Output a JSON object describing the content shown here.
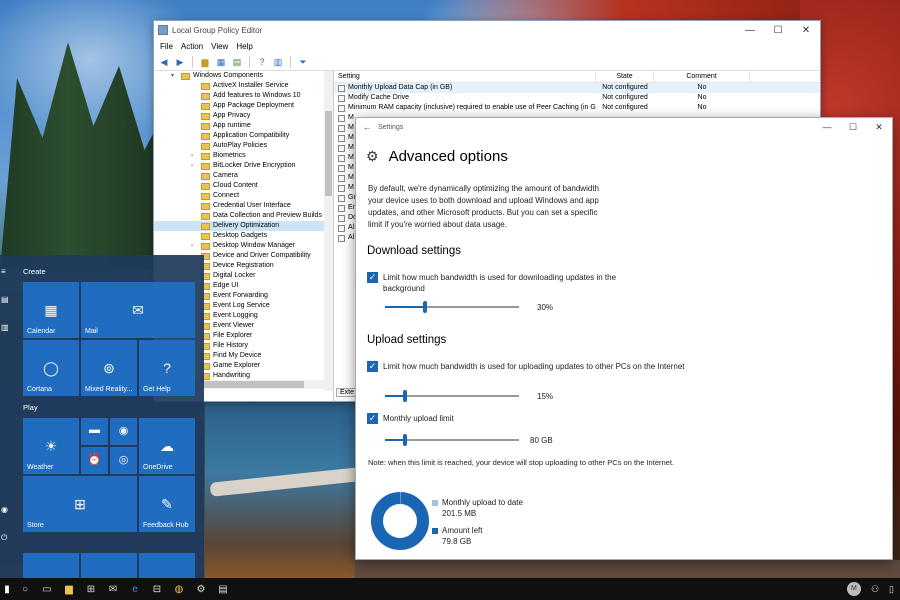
{
  "gpe": {
    "title": "Local Group Policy Editor",
    "menu": [
      "File",
      "Action",
      "View",
      "Help"
    ],
    "tree_root": "Windows Components",
    "tree_items": [
      "ActiveX Installer Service",
      "Add features to Windows 10",
      "App Package Deployment",
      "App Privacy",
      "App runtime",
      "Application Compatibility",
      "AutoPlay Policies",
      "Biometrics",
      "BitLocker Drive Encryption",
      "Camera",
      "Cloud Content",
      "Connect",
      "Credential User Interface",
      "Data Collection and Preview Builds",
      "Delivery Optimization",
      "Desktop Gadgets",
      "Desktop Window Manager",
      "Device and Driver Compatibility",
      "Device Registration",
      "Digital Locker",
      "Edge UI",
      "Event Forwarding",
      "Event Log Service",
      "Event Logging",
      "Event Viewer",
      "File Explorer",
      "File History",
      "Find My Device",
      "Game Explorer",
      "Handwriting"
    ],
    "selected_tree_item": "Delivery Optimization",
    "columns": {
      "setting": "Setting",
      "state": "State",
      "comment": "Comment"
    },
    "settings_rows": [
      {
        "name": "Monthly Upload Data Cap (in GB)",
        "state": "Not configured",
        "comment": "No"
      },
      {
        "name": "Modify Cache Drive",
        "state": "Not configured",
        "comment": "No"
      },
      {
        "name": "Minimum RAM capacity (inclusive) required to enable use of Peer Caching (in GB)",
        "state": "Not configured",
        "comment": "No"
      },
      {
        "name": "M",
        "state": "",
        "comment": ""
      },
      {
        "name": "M",
        "state": "",
        "comment": ""
      },
      {
        "name": "M",
        "state": "",
        "comment": ""
      },
      {
        "name": "M",
        "state": "",
        "comment": ""
      },
      {
        "name": "M",
        "state": "",
        "comment": ""
      },
      {
        "name": "M",
        "state": "",
        "comment": ""
      },
      {
        "name": "M",
        "state": "",
        "comment": ""
      },
      {
        "name": "M",
        "state": "",
        "comment": ""
      },
      {
        "name": "Gr",
        "state": "",
        "comment": ""
      },
      {
        "name": "En",
        "state": "",
        "comment": ""
      },
      {
        "name": "Do",
        "state": "",
        "comment": ""
      },
      {
        "name": "Al",
        "state": "",
        "comment": ""
      },
      {
        "name": "Al",
        "state": "",
        "comment": ""
      }
    ],
    "ext_tab": "Exte"
  },
  "settings": {
    "window_title": "Settings",
    "heading": "Advanced options",
    "intro": "By default, we're dynamically optimizing the amount of bandwidth your device uses to both download and upload Windows and app updates, and other Microsoft products. But you can set a specific limit if you're worried about data usage.",
    "download_title": "Download settings",
    "download_check_label": "Limit how much bandwidth is used for downloading updates in the background",
    "download_value": "30%",
    "download_fraction": 0.3,
    "upload_title": "Upload settings",
    "upload_check_label": "Limit how much bandwidth is used for uploading updates to other PCs on the Internet",
    "upload_value": "15%",
    "upload_fraction": 0.15,
    "monthly_check_label": "Monthly upload limit",
    "monthly_value": "80 GB",
    "monthly_fraction": 0.15,
    "note": "Note: when this limit is reached, your device will stop uploading to other PCs on the Internet.",
    "monthly_to_date_label": "Monthly upload to date",
    "monthly_to_date_value": "201.5 MB",
    "amount_left_label": "Amount left",
    "amount_left_value": "79.8 GB",
    "donut_used_fraction": 0.0025,
    "colors": {
      "accent": "#1a66b3",
      "light": "#9fc3e8"
    }
  },
  "start_menu": {
    "create_label": "Create",
    "play_label": "Play",
    "tiles": {
      "calendar": "Calendar",
      "mail": "Mail",
      "cortana": "Cortana",
      "mixed_reality": "Mixed Reality...",
      "get_help": "Get Help",
      "weather": "Weather",
      "onedrive": "OneDrive",
      "store": "Store",
      "feedback_hub": "Feedback Hub"
    }
  },
  "taskbar": {
    "avatar_initial": "M"
  }
}
